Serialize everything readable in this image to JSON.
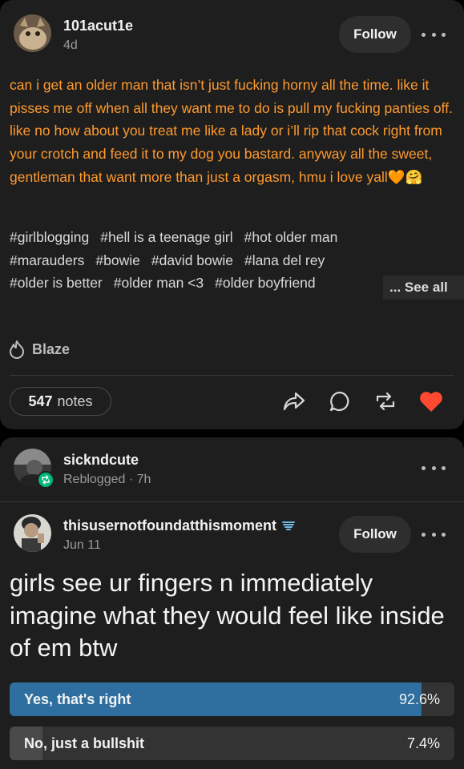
{
  "post1": {
    "username": "101acut1e",
    "time": "4d",
    "follow_label": "Follow",
    "body": "can i get an older man that isn’t just fucking horny all the time. like it pisses me off when all they want me to do is pull my fucking panties off. like no how about you treat me like a lady or i’ll rip that cock right from your crotch and feed it to my dog you bastard. anyway all the sweet, gentleman that want more than just a orgasm, hmu i love yall🧡🤗",
    "tags_rows": [
      [
        "#girlblogging",
        "#hell is a teenage girl",
        "#hot older man"
      ],
      [
        "#marauders",
        "#bowie",
        "#david bowie",
        "#lana del rey"
      ],
      [
        "#older is better",
        "#older man <3",
        "#older boyfriend"
      ]
    ],
    "see_all_label": "... See all",
    "blaze_label": "Blaze",
    "notes_count": "547",
    "notes_label": "notes",
    "body_color": "#ff9a2e",
    "like_color": "#ff4930"
  },
  "post2": {
    "reblogger": {
      "username": "sickndcute",
      "meta": "Reblogged · 7h"
    },
    "author": {
      "username": "thisusernotfoundatthismoment",
      "time": "Jun 11",
      "follow_label": "Follow"
    },
    "title": "girls see ur fingers n immediately imagine what they would feel like inside of em btw",
    "poll": [
      {
        "label": "Yes, that's right",
        "percent_label": "92.6%",
        "fraction": 0.926,
        "fill_color": "#2e6fa0"
      },
      {
        "label": "No, just a bullshit",
        "percent_label": "7.4%",
        "fraction": 0.074,
        "fill_color": "#4a4a4a"
      }
    ]
  }
}
